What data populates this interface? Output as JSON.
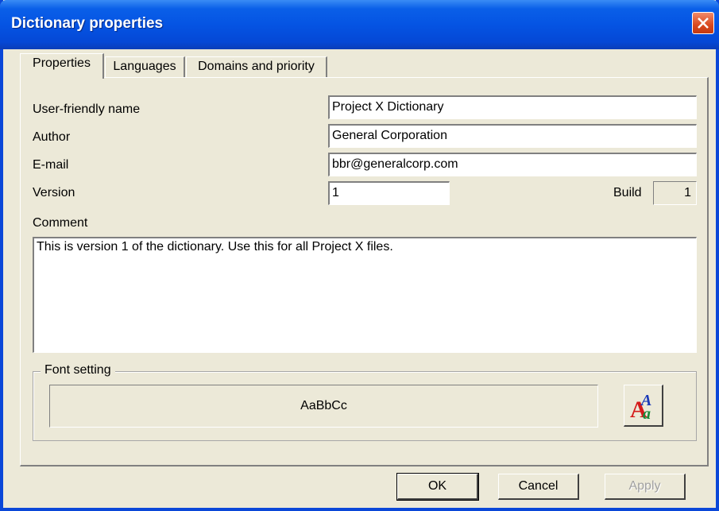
{
  "window": {
    "title": "Dictionary properties"
  },
  "tabs": [
    {
      "label": "Properties",
      "active": true
    },
    {
      "label": "Languages",
      "active": false
    },
    {
      "label": "Domains and priority",
      "active": false
    }
  ],
  "form": {
    "user_friendly_name": {
      "label": "User-friendly name",
      "value": "Project X Dictionary"
    },
    "author": {
      "label": "Author",
      "value": "General Corporation"
    },
    "email": {
      "label": "E-mail",
      "value": "bbr@generalcorp.com"
    },
    "version": {
      "label": "Version",
      "value": "1"
    },
    "build": {
      "label": "Build",
      "value": "1"
    },
    "comment": {
      "label": "Comment",
      "value": "This is version 1 of the dictionary. Use this for all Project X files."
    }
  },
  "font_setting": {
    "legend": "Font setting",
    "preview_text": "AaBbCc",
    "button_icon": "font-icon"
  },
  "buttons": {
    "ok": "OK",
    "cancel": "Cancel",
    "apply": "Apply",
    "apply_enabled": false
  },
  "colors": {
    "titlebar": "#0554e3",
    "dialog_bg": "#ece9d8",
    "close_button": "#d9481e"
  }
}
